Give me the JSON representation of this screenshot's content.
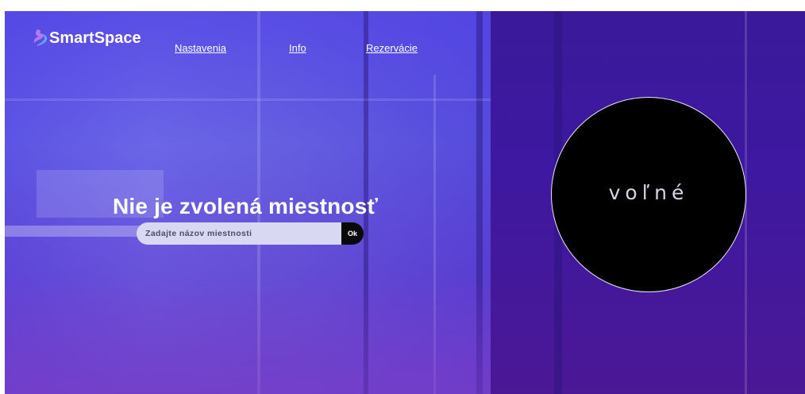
{
  "brand": {
    "name": "SmartSpace",
    "icon": "smartspace-logo-icon",
    "accent": "#a96ff0"
  },
  "nav": {
    "items": [
      {
        "label": "Nastavenia"
      },
      {
        "label": "Info"
      },
      {
        "label": "Rezervácie"
      }
    ]
  },
  "hero": {
    "title": "Nie je zvolená miestnosť",
    "search": {
      "placeholder": "Zadajte názov miestnosti",
      "value": "",
      "button_label": "Ok"
    }
  },
  "status": {
    "text": "voľné",
    "circle_color": "#000000",
    "border_color": "#e8e4f5"
  },
  "colors": {
    "background_primary": "#3a1bb0",
    "background_secondary": "#4b1896"
  }
}
